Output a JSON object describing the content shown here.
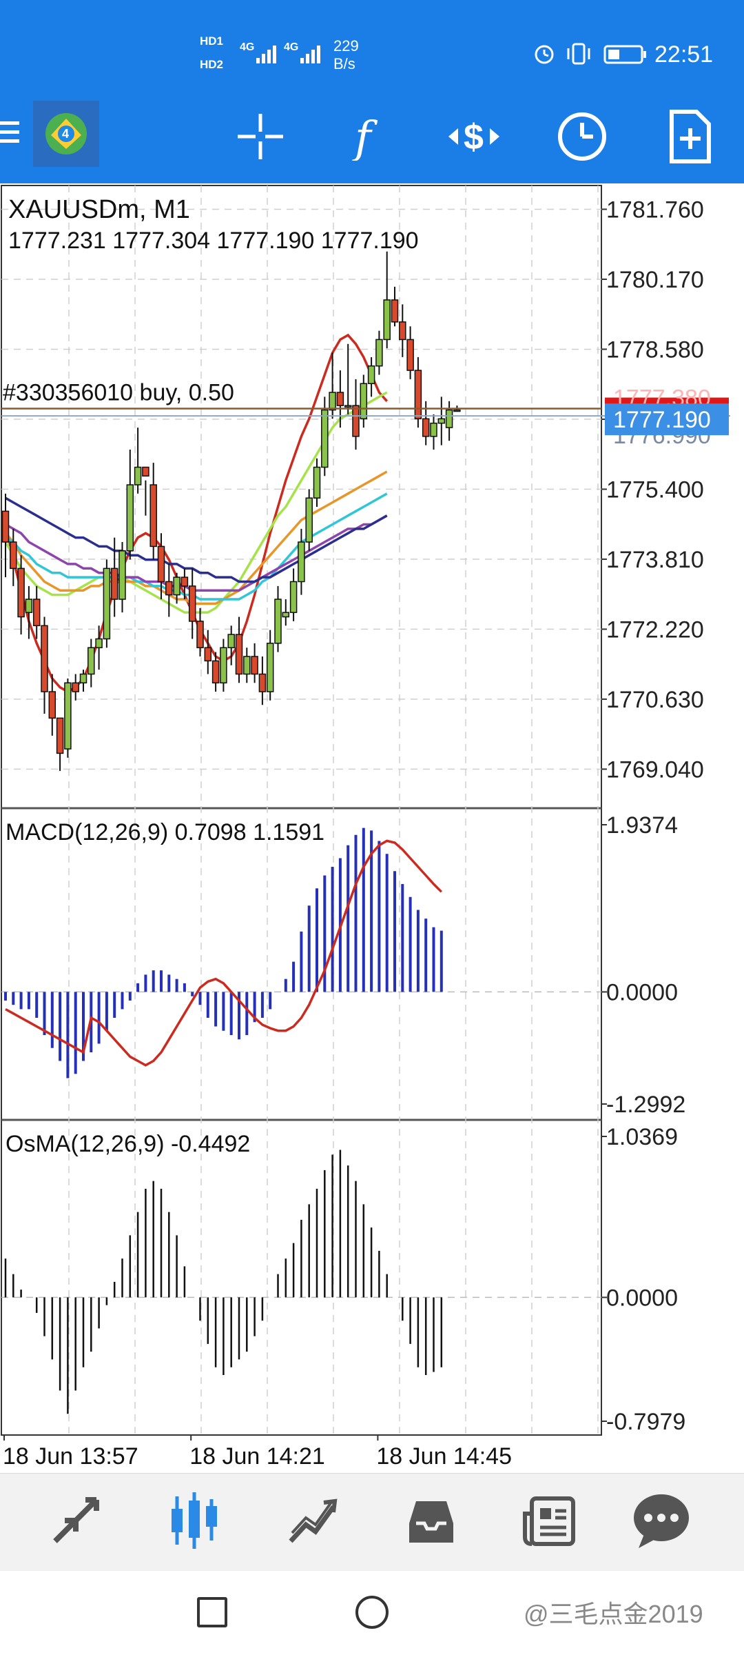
{
  "status_bar": {
    "hd1": "HD1",
    "hd2": "HD2",
    "net1": "4G",
    "net2": "4G",
    "speed_value": "229",
    "speed_unit": "B/s",
    "time": "22:51"
  },
  "toolbar": {
    "menu_icon": "menu-icon",
    "logo_icon": "mt4-logo-icon",
    "buttons": [
      "crosshair-icon",
      "function-icon",
      "trade-dollar-icon",
      "clock-icon",
      "new-order-icon"
    ]
  },
  "colors": {
    "bar": "#1b7ee6",
    "bull": "#8bc34a",
    "bear": "#d84a2b",
    "bid_line": "#c0392b",
    "ask_label": "#3b8fe5"
  },
  "chart_data": [
    {
      "type": "candlestick",
      "title": "XAUUSDm, M1",
      "ohlc_text": "1777.231 1777.304 1777.190 1777.190",
      "order_label": "#330356010 buy, 0.50",
      "order_price": 1777.231,
      "current_price_label": "1777.190",
      "current_price": 1777.19,
      "hidden_price_label": "1777.380",
      "hidden_label2": "1776.990",
      "ylim": [
        1768.2,
        1782.3
      ],
      "y_ticks": [
        "1781.760",
        "1780.170",
        "1778.580",
        "1776.990",
        "1775.400",
        "1773.810",
        "1772.220",
        "1770.630",
        "1769.040"
      ],
      "x_tick_labels": [
        "18 Jun 13:57",
        "18 Jun 14:21",
        "18 Jun 14:45"
      ],
      "x_tick_index": [
        0,
        24,
        48
      ],
      "candles": [
        [
          1774.9,
          1775.3,
          1773.4,
          1774.2
        ],
        [
          1774.2,
          1774.5,
          1773.2,
          1773.6
        ],
        [
          1773.6,
          1773.9,
          1772.1,
          1772.5
        ],
        [
          1772.6,
          1773.2,
          1772.0,
          1772.9
        ],
        [
          1772.9,
          1773.2,
          1772.0,
          1772.3
        ],
        [
          1772.3,
          1772.5,
          1770.3,
          1770.8
        ],
        [
          1770.8,
          1771.2,
          1769.8,
          1770.2
        ],
        [
          1770.2,
          1769.6,
          1769.0,
          1769.4
        ],
        [
          1769.5,
          1771.1,
          1769.3,
          1771.0
        ],
        [
          1771.0,
          1771.2,
          1770.6,
          1770.8
        ],
        [
          1771.0,
          1771.3,
          1770.8,
          1771.2
        ],
        [
          1771.2,
          1772.0,
          1770.9,
          1771.8
        ],
        [
          1771.8,
          1772.3,
          1771.3,
          1772.0
        ],
        [
          1772.0,
          1773.8,
          1771.8,
          1773.6
        ],
        [
          1773.6,
          1774.3,
          1772.5,
          1772.9
        ],
        [
          1772.9,
          1774.2,
          1772.6,
          1774.0
        ],
        [
          1774.0,
          1776.3,
          1773.8,
          1775.5
        ],
        [
          1775.5,
          1776.8,
          1775.3,
          1775.9
        ],
        [
          1775.9,
          1775.6,
          1774.8,
          1775.7
        ],
        [
          1775.5,
          1776.0,
          1773.8,
          1774.1
        ],
        [
          1774.1,
          1774.4,
          1772.9,
          1773.3
        ],
        [
          1773.3,
          1773.7,
          1772.5,
          1773.0
        ],
        [
          1773.0,
          1773.5,
          1772.8,
          1773.4
        ],
        [
          1773.4,
          1773.6,
          1772.9,
          1773.2
        ],
        [
          1773.2,
          1773.6,
          1772.0,
          1772.4
        ],
        [
          1772.4,
          1772.7,
          1771.6,
          1771.8
        ],
        [
          1771.8,
          1772.2,
          1771.2,
          1771.5
        ],
        [
          1771.5,
          1771.7,
          1770.8,
          1771.0
        ],
        [
          1771.0,
          1772.0,
          1770.8,
          1771.8
        ],
        [
          1771.8,
          1772.3,
          1771.4,
          1772.1
        ],
        [
          1772.1,
          1772.5,
          1771.0,
          1771.2
        ],
        [
          1771.2,
          1771.8,
          1771.0,
          1771.6
        ],
        [
          1771.6,
          1771.9,
          1771.0,
          1771.2
        ],
        [
          1771.2,
          1771.6,
          1770.5,
          1770.8
        ],
        [
          1770.8,
          1772.2,
          1770.6,
          1771.9
        ],
        [
          1771.9,
          1773.2,
          1771.7,
          1772.9
        ],
        [
          1772.5,
          1772.9,
          1772.3,
          1772.6
        ],
        [
          1772.6,
          1773.6,
          1772.4,
          1773.3
        ],
        [
          1773.3,
          1774.5,
          1773.0,
          1774.2
        ],
        [
          1774.2,
          1775.4,
          1774.0,
          1775.2
        ],
        [
          1775.2,
          1776.1,
          1775.0,
          1775.9
        ],
        [
          1775.9,
          1777.5,
          1775.7,
          1777.2
        ],
        [
          1777.2,
          1778.5,
          1777.0,
          1777.6
        ],
        [
          1777.6,
          1778.1,
          1776.8,
          1777.3
        ],
        [
          1777.3,
          1778.7,
          1777.1,
          1777.3
        ],
        [
          1777.3,
          1777.9,
          1776.3,
          1776.6
        ],
        [
          1777.0,
          1778.0,
          1776.8,
          1777.8
        ],
        [
          1777.8,
          1778.4,
          1777.5,
          1778.2
        ],
        [
          1778.2,
          1779.0,
          1778.0,
          1778.8
        ],
        [
          1778.8,
          1780.8,
          1778.6,
          1779.7
        ],
        [
          1779.7,
          1780.0,
          1779.1,
          1779.2
        ],
        [
          1779.2,
          1779.6,
          1778.4,
          1778.8
        ],
        [
          1778.8,
          1779.1,
          1777.9,
          1778.1
        ],
        [
          1778.1,
          1778.4,
          1776.8,
          1777.0
        ],
        [
          1777.0,
          1777.4,
          1776.4,
          1776.6
        ],
        [
          1776.6,
          1777.1,
          1776.3,
          1776.9
        ],
        [
          1776.9,
          1777.5,
          1776.4,
          1777.0
        ],
        [
          1776.8,
          1777.4,
          1776.5,
          1777.2
        ],
        [
          1777.2,
          1777.3,
          1777.19,
          1777.19
        ]
      ],
      "moving_averages": [
        {
          "color": "#cc2a1e",
          "values": [
            1774.6,
            1773.8,
            1773.1,
            1772.4,
            1771.9,
            1771.5,
            1771.1,
            1770.9,
            1770.8,
            1770.9,
            1771.1,
            1771.5,
            1772.0,
            1772.6,
            1773.1,
            1773.6,
            1774.0,
            1774.3,
            1774.4,
            1774.3,
            1774.1,
            1773.8,
            1773.4,
            1773.0,
            1772.6,
            1772.2,
            1771.9,
            1771.6,
            1771.5,
            1771.6,
            1771.9,
            1772.4,
            1773.0,
            1773.7,
            1774.4,
            1775.0,
            1775.6,
            1776.1,
            1776.6,
            1777.0,
            1777.5,
            1778.0,
            1778.5,
            1778.8,
            1778.9,
            1778.7,
            1778.4,
            1778.0,
            1777.6,
            1777.4
          ]
        },
        {
          "color": "#a6e34a",
          "values": [
            1774.2,
            1773.9,
            1773.6,
            1773.4,
            1773.2,
            1773.1,
            1773.0,
            1773.0,
            1773.0,
            1773.1,
            1773.2,
            1773.3,
            1773.4,
            1773.4,
            1773.4,
            1773.4,
            1773.3,
            1773.2,
            1773.1,
            1773.0,
            1772.9,
            1772.8,
            1772.7,
            1772.6,
            1772.6,
            1772.6,
            1772.6,
            1772.7,
            1772.9,
            1773.1,
            1773.3,
            1773.6,
            1773.9,
            1774.2,
            1774.5,
            1774.8,
            1775.0,
            1775.3,
            1775.6,
            1775.9,
            1776.2,
            1776.5,
            1776.8,
            1777.0,
            1777.1,
            1777.2,
            1777.3,
            1777.4,
            1777.5,
            1777.6
          ]
        },
        {
          "color": "#e8952a",
          "values": [
            1774.4,
            1774.2,
            1773.9,
            1773.7,
            1773.5,
            1773.3,
            1773.2,
            1773.1,
            1773.1,
            1773.1,
            1773.1,
            1773.2,
            1773.2,
            1773.3,
            1773.3,
            1773.3,
            1773.3,
            1773.3,
            1773.2,
            1773.2,
            1773.1,
            1773.0,
            1772.9,
            1772.9,
            1772.8,
            1772.8,
            1772.8,
            1772.8,
            1772.9,
            1773.0,
            1773.1,
            1773.3,
            1773.5,
            1773.7,
            1773.9,
            1774.1,
            1774.3,
            1774.5,
            1774.7,
            1774.8,
            1774.9,
            1775.0,
            1775.1,
            1775.2,
            1775.3,
            1775.4,
            1775.5,
            1775.6,
            1775.7,
            1775.8
          ]
        },
        {
          "color": "#2fc6d8",
          "values": [
            1774.3,
            1774.2,
            1774.0,
            1773.9,
            1773.7,
            1773.6,
            1773.5,
            1773.5,
            1773.4,
            1773.4,
            1773.4,
            1773.4,
            1773.4,
            1773.4,
            1773.4,
            1773.4,
            1773.4,
            1773.3,
            1773.3,
            1773.2,
            1773.2,
            1773.1,
            1773.1,
            1773.0,
            1773.0,
            1772.9,
            1772.9,
            1772.9,
            1772.9,
            1772.9,
            1772.9,
            1773.0,
            1773.1,
            1773.3,
            1773.4,
            1773.6,
            1773.8,
            1774.0,
            1774.2,
            1774.3,
            1774.4,
            1774.5,
            1774.6,
            1774.7,
            1774.8,
            1774.9,
            1775.0,
            1775.1,
            1775.2,
            1775.3
          ]
        },
        {
          "color": "#8e44ad",
          "values": [
            1774.6,
            1774.5,
            1774.4,
            1774.2,
            1774.1,
            1774.0,
            1773.9,
            1773.8,
            1773.7,
            1773.7,
            1773.6,
            1773.6,
            1773.5,
            1773.5,
            1773.5,
            1773.4,
            1773.4,
            1773.4,
            1773.3,
            1773.3,
            1773.3,
            1773.2,
            1773.2,
            1773.2,
            1773.1,
            1773.1,
            1773.1,
            1773.1,
            1773.1,
            1773.1,
            1773.1,
            1773.2,
            1773.3,
            1773.4,
            1773.5,
            1773.6,
            1773.7,
            1773.8,
            1773.9,
            1774.0,
            1774.1,
            1774.2,
            1774.3,
            1774.4,
            1774.5,
            1774.5,
            1774.6,
            1774.6,
            1774.7,
            1774.8
          ]
        },
        {
          "color": "#2a2f8f",
          "values": [
            1775.2,
            1775.1,
            1775.0,
            1774.9,
            1774.8,
            1774.7,
            1774.6,
            1774.5,
            1774.4,
            1774.3,
            1774.3,
            1774.2,
            1774.1,
            1774.1,
            1774.0,
            1774.0,
            1773.9,
            1773.9,
            1773.8,
            1773.8,
            1773.8,
            1773.7,
            1773.7,
            1773.6,
            1773.6,
            1773.5,
            1773.5,
            1773.4,
            1773.4,
            1773.4,
            1773.3,
            1773.3,
            1773.3,
            1773.4,
            1773.4,
            1773.5,
            1773.6,
            1773.7,
            1773.8,
            1773.9,
            1774.0,
            1774.1,
            1774.2,
            1774.3,
            1774.4,
            1774.5,
            1774.5,
            1774.6,
            1774.7,
            1774.8
          ]
        }
      ]
    },
    {
      "type": "bar",
      "title": "MACD(12,26,9) 0.7098 1.1591",
      "ylim": [
        -1.2992,
        1.9374
      ],
      "y_ticks": [
        "1.9374",
        "0.0000",
        "-1.2992"
      ],
      "values": [
        -0.1,
        -0.15,
        -0.2,
        -0.2,
        -0.3,
        -0.5,
        -0.65,
        -0.8,
        -1.0,
        -0.95,
        -0.8,
        -0.7,
        -0.6,
        -0.45,
        -0.3,
        -0.2,
        -0.1,
        0.1,
        0.2,
        0.25,
        0.25,
        0.2,
        0.15,
        0.1,
        -0.05,
        -0.15,
        -0.3,
        -0.4,
        -0.45,
        -0.5,
        -0.55,
        -0.5,
        -0.35,
        -0.3,
        -0.2,
        0.0,
        0.15,
        0.35,
        0.7,
        1.0,
        1.2,
        1.35,
        1.45,
        1.55,
        1.7,
        1.82,
        1.9,
        1.87,
        1.75,
        1.6,
        1.4,
        1.25,
        1.1,
        0.95,
        0.85,
        0.75,
        0.71
      ],
      "signal": [
        -0.3,
        -0.35,
        -0.45,
        -0.55,
        -0.65,
        -0.75,
        -0.8,
        -0.85,
        -0.8,
        -0.7,
        -0.55,
        -0.4,
        -0.25,
        -0.1,
        0.05,
        0.12,
        0.15,
        0.1,
        0.0,
        -0.1,
        -0.2,
        -0.3,
        -0.38,
        -0.42,
        -0.45,
        -0.45,
        -0.4,
        -0.3,
        -0.15,
        0.05,
        0.25,
        0.5,
        0.75,
        1.0,
        1.25,
        1.45,
        1.6,
        1.7,
        1.75,
        1.73,
        1.65,
        1.55,
        1.45,
        1.35,
        1.25,
        1.16
      ],
      "bar_color": "#2430b8",
      "signal_color": "#cc2a1e"
    },
    {
      "type": "bar",
      "title": "OsMA(12,26,9) -0.4492",
      "ylim": [
        -0.7979,
        1.0369
      ],
      "y_ticks": [
        "1.0369",
        "0.0000",
        "-0.7979"
      ],
      "values": [
        0.25,
        0.15,
        0.05,
        0.0,
        -0.1,
        -0.25,
        -0.4,
        -0.6,
        -0.75,
        -0.6,
        -0.45,
        -0.35,
        -0.2,
        -0.05,
        0.1,
        0.25,
        0.4,
        0.55,
        0.7,
        0.75,
        0.7,
        0.55,
        0.4,
        0.2,
        0.0,
        -0.15,
        -0.3,
        -0.45,
        -0.5,
        -0.45,
        -0.4,
        -0.35,
        -0.25,
        -0.15,
        0.0,
        0.15,
        0.25,
        0.35,
        0.5,
        0.6,
        0.7,
        0.82,
        0.92,
        0.95,
        0.85,
        0.75,
        0.6,
        0.45,
        0.3,
        0.15,
        0.0,
        -0.15,
        -0.3,
        -0.45,
        -0.5,
        -0.48,
        -0.45
      ],
      "bar_color": "#111111"
    }
  ],
  "bottom_nav": [
    "quotes-icon",
    "chart-icon",
    "trade-icon",
    "history-icon",
    "news-icon",
    "chat-icon"
  ],
  "system_nav": [
    "recent-apps-icon",
    "home-icon"
  ],
  "watermark": "@三毛点金2019"
}
